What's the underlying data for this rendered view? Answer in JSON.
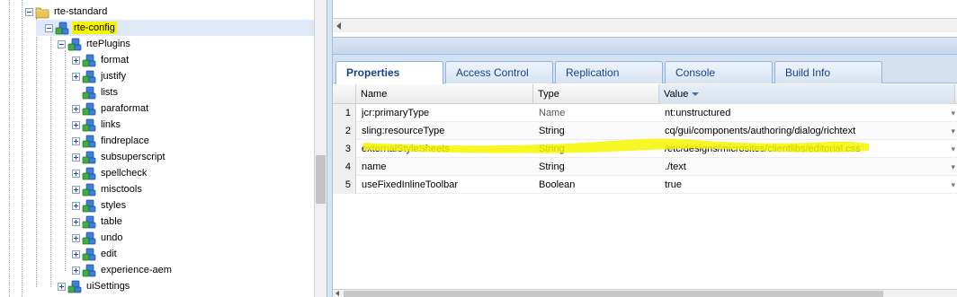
{
  "tree": {
    "items": [
      {
        "label": "rte-standard",
        "icon": "folder-icon",
        "expander": "minus"
      },
      {
        "label": "rte-config",
        "icon": "node-icon",
        "expander": "minus",
        "selected": true,
        "highlighted": true
      },
      {
        "label": "rtePlugins",
        "icon": "node-icon",
        "expander": "minus"
      },
      {
        "label": "format",
        "icon": "node-icon",
        "expander": "plus"
      },
      {
        "label": "justify",
        "icon": "node-icon",
        "expander": "plus"
      },
      {
        "label": "lists",
        "icon": "node-icon",
        "expander": "none"
      },
      {
        "label": "paraformat",
        "icon": "node-icon",
        "expander": "plus"
      },
      {
        "label": "links",
        "icon": "node-icon",
        "expander": "plus"
      },
      {
        "label": "findreplace",
        "icon": "node-icon",
        "expander": "plus"
      },
      {
        "label": "subsuperscript",
        "icon": "node-icon",
        "expander": "plus"
      },
      {
        "label": "spellcheck",
        "icon": "node-icon",
        "expander": "plus"
      },
      {
        "label": "misctools",
        "icon": "node-icon",
        "expander": "plus"
      },
      {
        "label": "styles",
        "icon": "node-icon",
        "expander": "plus"
      },
      {
        "label": "table",
        "icon": "node-icon",
        "expander": "plus"
      },
      {
        "label": "undo",
        "icon": "node-icon",
        "expander": "plus"
      },
      {
        "label": "edit",
        "icon": "node-icon",
        "expander": "plus"
      },
      {
        "label": "experience-aem",
        "icon": "node-icon",
        "expander": "plus"
      },
      {
        "label": "uiSettings",
        "icon": "node-icon",
        "expander": "plus"
      }
    ]
  },
  "tabs": [
    {
      "label": "Properties",
      "active": true
    },
    {
      "label": "Access Control",
      "active": false
    },
    {
      "label": "Replication",
      "active": false
    },
    {
      "label": "Console",
      "active": false
    },
    {
      "label": "Build Info",
      "active": false
    }
  ],
  "grid": {
    "columns": [
      "Name",
      "Type",
      "Value"
    ],
    "sorted_column": "Value",
    "rows": [
      {
        "num": "1",
        "name": "jcr:primaryType",
        "type": "Name",
        "value": "nt:unstructured"
      },
      {
        "num": "2",
        "name": "sling:resourceType",
        "type": "String",
        "value": "cq/gui/components/authoring/dialog/richtext"
      },
      {
        "num": "3",
        "name": "externalStyleSheets",
        "type": "String",
        "value": "/etc/designs/microsites/clientlibs/editorial.css",
        "highlighted": true
      },
      {
        "num": "4",
        "name": "name",
        "type": "String",
        "value": "./text"
      },
      {
        "num": "5",
        "name": "useFixedInlineToolbar",
        "type": "Boolean",
        "value": "true"
      }
    ]
  },
  "colors": {
    "highlight": "#f6f600",
    "selection": "#dfe8f6",
    "tab_text": "#15428b",
    "panel_border": "#99bbe8"
  }
}
